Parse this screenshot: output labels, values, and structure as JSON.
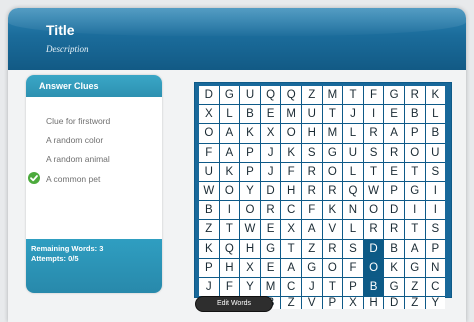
{
  "header": {
    "title": "Title",
    "description": "Description"
  },
  "clues": {
    "heading": "Answer Clues",
    "items": [
      {
        "label": "Clue for firstword",
        "found": false
      },
      {
        "label": "A random color",
        "found": false
      },
      {
        "label": "A random animal",
        "found": false
      },
      {
        "label": "A common pet",
        "found": true
      }
    ],
    "remaining": "Remaining Words: 3",
    "attempts": "Attempts: 0/5"
  },
  "grid": {
    "rows": [
      "DGUQQZMTFGRKDE",
      "XLBEMUTJIEBLOE",
      "OAKXOHMLRAPBNE",
      "FAPJKSGUSROUKT",
      "UKPJFROLTETSEJ",
      "WOYDHRRQWPGIYU",
      "BIORCFKNODIILX",
      "ZTWEXAVLRRTSFM",
      "KQHGTZRSDBAPKI",
      "PHXEAGOFOKGNLF",
      "JFYMCJTPBGZCJG",
      "GJTBZVPXHDZYFE"
    ],
    "highlight": [
      [
        8,
        8
      ],
      [
        9,
        8
      ],
      [
        10,
        8
      ]
    ],
    "highlight_color": "#0d5a86"
  },
  "footer": {
    "edit_label": "Edit Words"
  },
  "colors": {
    "header": "#1b6c9b",
    "panel": "#2d91b1",
    "check": "#4caa3c"
  }
}
